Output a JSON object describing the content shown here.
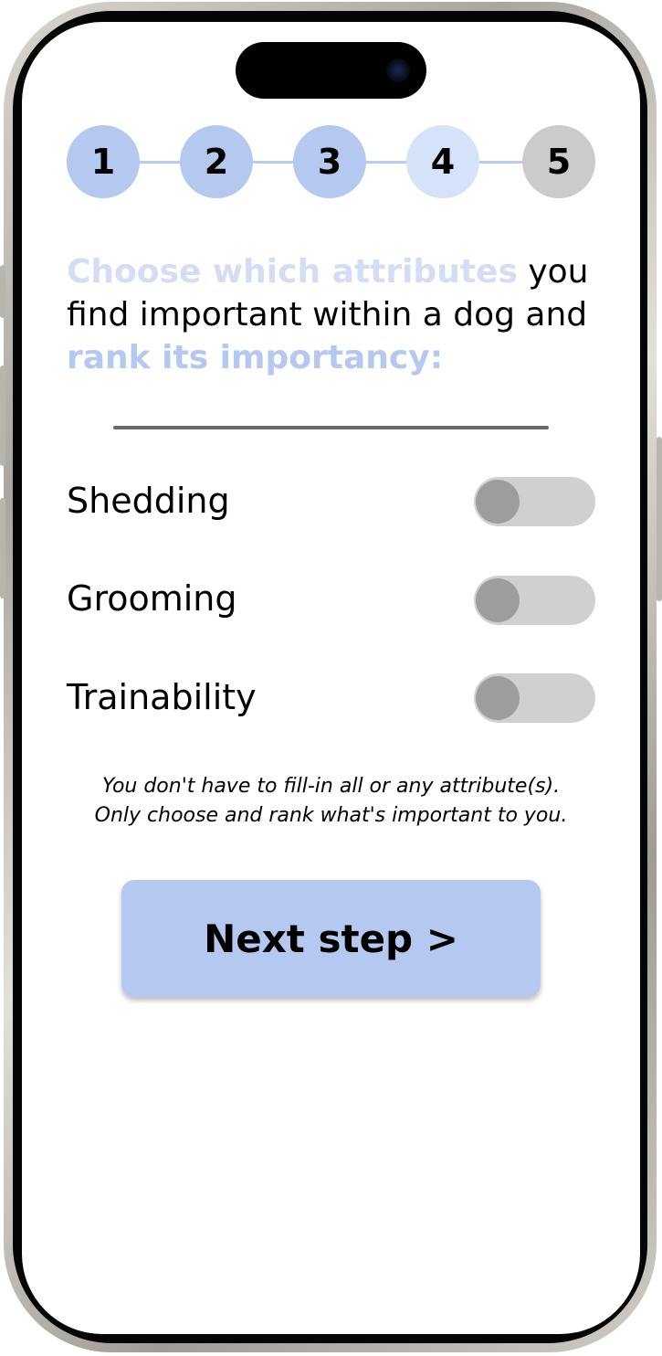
{
  "stepper": {
    "steps": [
      {
        "label": "1",
        "state": "done"
      },
      {
        "label": "2",
        "state": "done"
      },
      {
        "label": "3",
        "state": "done"
      },
      {
        "label": "4",
        "state": "current"
      },
      {
        "label": "5",
        "state": "upcoming"
      }
    ]
  },
  "heading": {
    "part1": "Choose which attributes",
    "part2": " you find important within a dog and ",
    "part3": "rank its importancy:"
  },
  "attributes": [
    {
      "label": "Shedding",
      "enabled": false
    },
    {
      "label": "Grooming",
      "enabled": false
    },
    {
      "label": "Trainability",
      "enabled": false
    }
  ],
  "note": {
    "line1": "You don't have to fill-in all or any attribute(s).",
    "line2": "Only choose and rank what's important to you."
  },
  "next_button": {
    "label": "Next step >"
  },
  "colors": {
    "accent": "#b5c9f0",
    "accent_light": "#d6e2f8",
    "inactive": "#cbcbcb",
    "toggle_track": "#d0d0d0",
    "toggle_knob": "#9d9d9d"
  }
}
